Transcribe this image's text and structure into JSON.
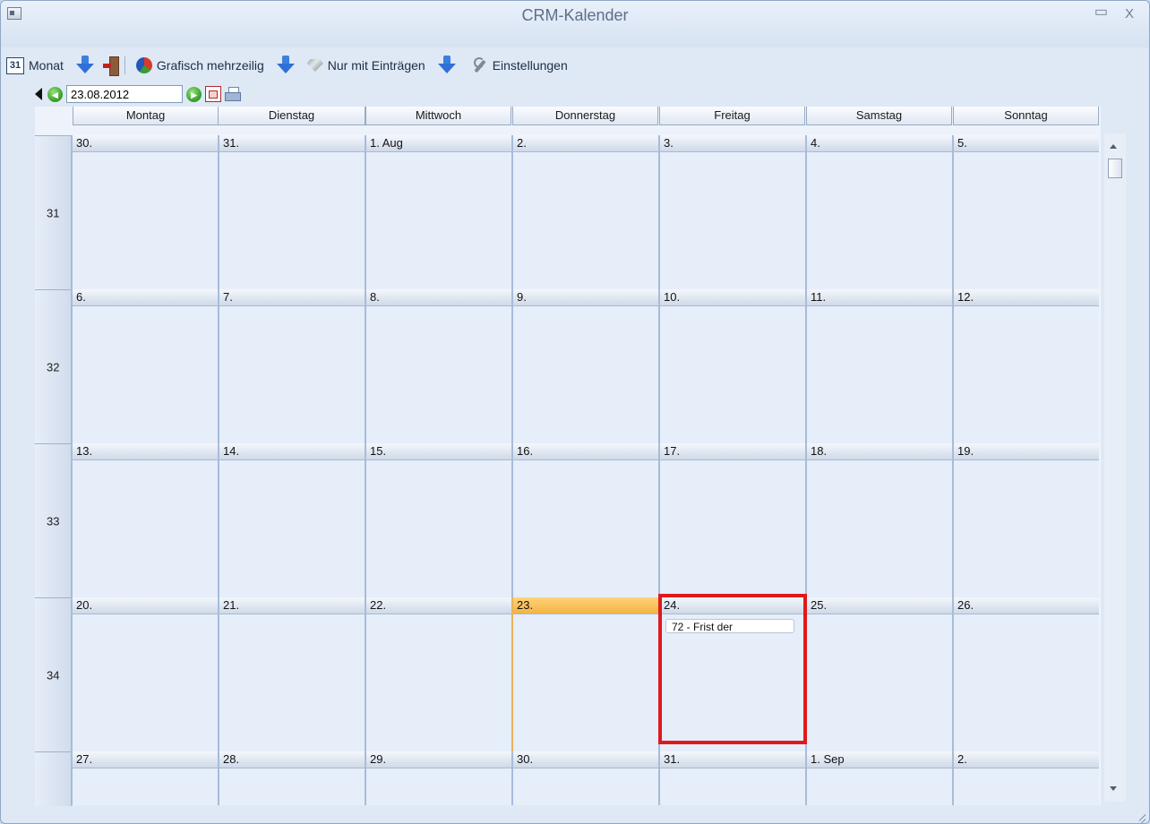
{
  "window": {
    "title": "CRM-Kalender",
    "minimize_glyph": "▭",
    "close_glyph": "X"
  },
  "toolbar": {
    "month_icon_text": "31",
    "month_label": "Monat",
    "graph_label": "Grafisch mehrzeilig",
    "entries_label": "Nur mit Einträgen",
    "settings_label": "Einstellungen"
  },
  "nav": {
    "date_value": "23.08.2012",
    "prev_glyph": "◀",
    "back_glyph": "◂",
    "fwd_glyph": "▸"
  },
  "calendar": {
    "days": [
      "Montag",
      "Dienstag",
      "Mittwoch",
      "Donnerstag",
      "Freitag",
      "Samstag",
      "Sonntag"
    ],
    "weeks": [
      {
        "number": "31",
        "days": [
          "30.",
          "31.",
          "1. Aug",
          "2.",
          "3.",
          "4.",
          "5."
        ]
      },
      {
        "number": "32",
        "days": [
          "6.",
          "7.",
          "8.",
          "9.",
          "10.",
          "11.",
          "12."
        ]
      },
      {
        "number": "33",
        "days": [
          "13.",
          "14.",
          "15.",
          "16.",
          "17.",
          "18.",
          "19."
        ]
      },
      {
        "number": "34",
        "days": [
          "20.",
          "21.",
          "22.",
          "23.",
          "24.",
          "25.",
          "26."
        ]
      },
      {
        "number": "",
        "days": [
          "27.",
          "28.",
          "29.",
          "30.",
          "31.",
          "1. Sep",
          "2."
        ]
      }
    ],
    "today": "23.",
    "event": {
      "day": "24.",
      "text": "72 - Frist der"
    }
  },
  "colors": {
    "today": "#f3b443",
    "highlight": "#e0191c",
    "accent": "#2f6fd6"
  }
}
